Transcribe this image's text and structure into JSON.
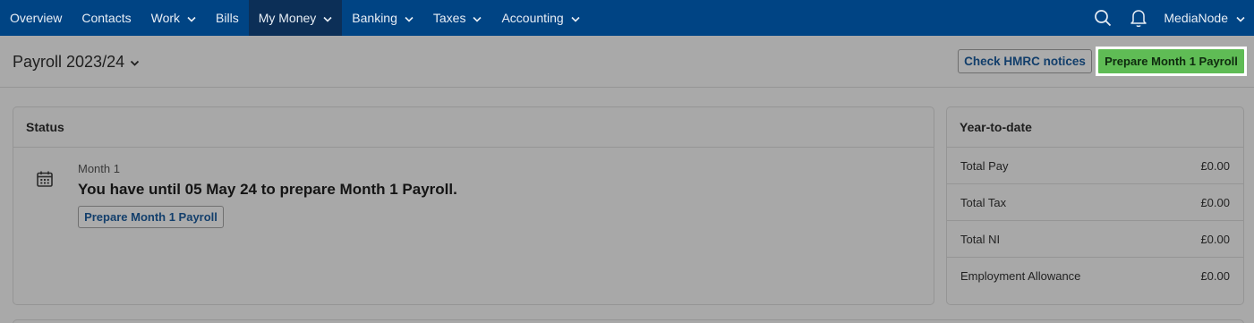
{
  "nav": {
    "items": [
      {
        "label": "Overview",
        "dropdown": false,
        "active": false
      },
      {
        "label": "Contacts",
        "dropdown": false,
        "active": false
      },
      {
        "label": "Work",
        "dropdown": true,
        "active": false
      },
      {
        "label": "Bills",
        "dropdown": false,
        "active": false
      },
      {
        "label": "My Money",
        "dropdown": true,
        "active": true
      },
      {
        "label": "Banking",
        "dropdown": true,
        "active": false
      },
      {
        "label": "Taxes",
        "dropdown": true,
        "active": false
      },
      {
        "label": "Accounting",
        "dropdown": true,
        "active": false
      }
    ],
    "account_name": "MediaNode",
    "icons": [
      "search-icon",
      "bell-icon",
      "chevron-down-icon"
    ]
  },
  "header": {
    "title": "Payroll 2023/24",
    "check_notices_label": "Check HMRC notices",
    "prepare_label": "Prepare Month 1 Payroll"
  },
  "status": {
    "heading": "Status",
    "month_label": "Month 1",
    "deadline_text": "You have until 05 May 24 to prepare Month 1 Payroll.",
    "prepare_label": "Prepare Month 1 Payroll",
    "icon": "calendar-icon"
  },
  "ytd": {
    "heading": "Year-to-date",
    "rows": [
      {
        "label": "Total Pay",
        "value": "£0.00"
      },
      {
        "label": "Total Tax",
        "value": "£0.00"
      },
      {
        "label": "Total NI",
        "value": "£0.00"
      },
      {
        "label": "Employment Allowance",
        "value": "£0.00"
      }
    ]
  },
  "colors": {
    "nav_bg": "#004484",
    "nav_active_bg": "#0c2f57",
    "primary_button": "#5fbc55",
    "overlay_bg": "#a9a9a9"
  }
}
